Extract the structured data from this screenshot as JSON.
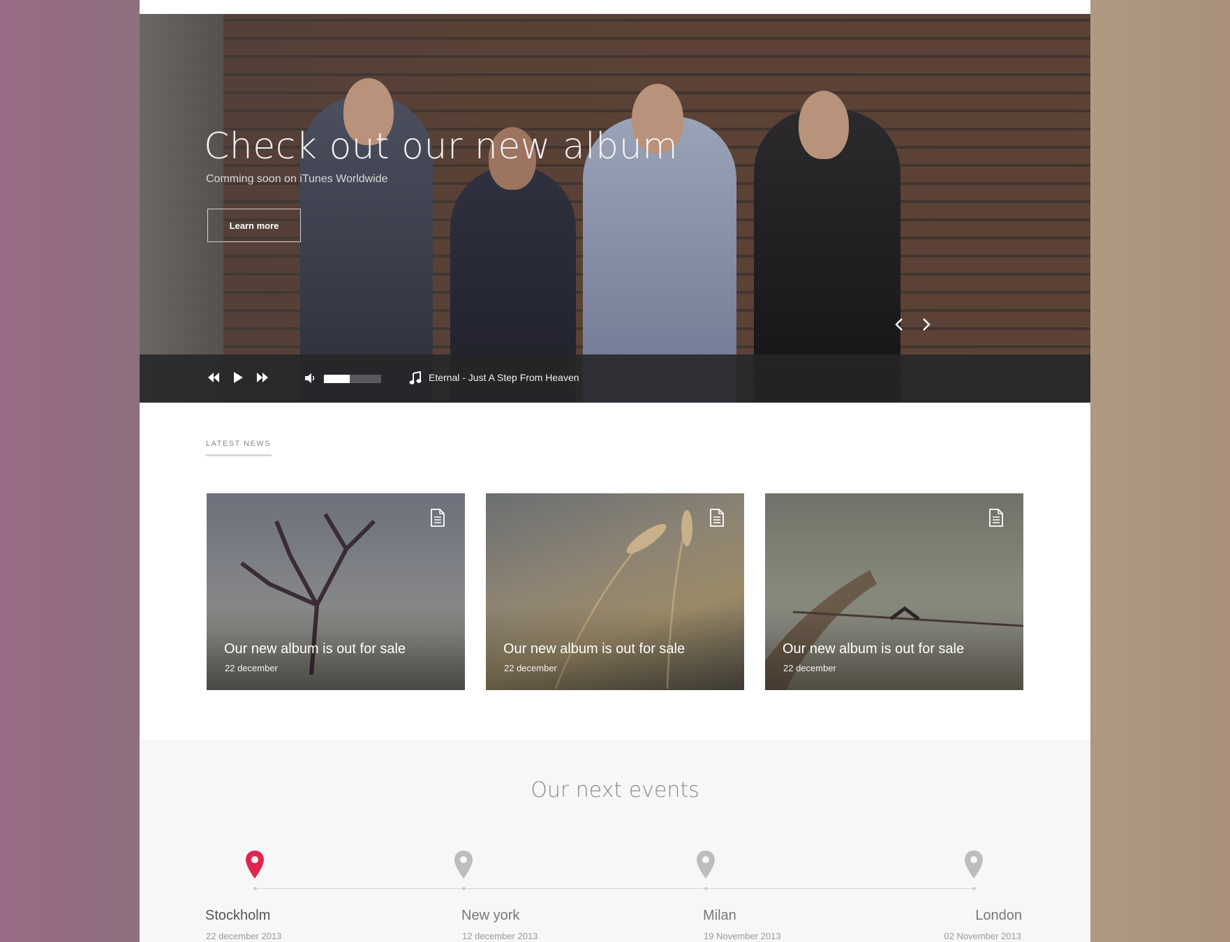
{
  "hero": {
    "title": "Check out our new album",
    "subtitle": "Comming soon on iTunes Worldwide",
    "cta_label": "Learn more"
  },
  "player": {
    "track": "Eternal - Just A Step From Heaven",
    "volume_level": 0.45,
    "icons": [
      "rewind-icon",
      "play-icon",
      "fast-forward-icon",
      "volume-icon",
      "music-note-icon"
    ]
  },
  "slider": {
    "icons": [
      "chevron-left-icon",
      "chevron-right-icon"
    ]
  },
  "news": {
    "heading": "LATEST NEWS",
    "items": [
      {
        "title": "Our new album is out for sale",
        "date": "22 december"
      },
      {
        "title": "Our new album is out for sale",
        "date": "22 december"
      },
      {
        "title": "Our new album is out for sale",
        "date": "22 december"
      }
    ]
  },
  "events": {
    "heading": "Our next events",
    "items": [
      {
        "city": "Stockholm",
        "date": "22 december 2013"
      },
      {
        "city": "New york",
        "date": "12 december 2013"
      },
      {
        "city": "Milan",
        "date": "19 November 2013"
      },
      {
        "city": "London",
        "date": "02 November 2013"
      }
    ]
  },
  "colors": {
    "accent": "#e0254e",
    "pin_inactive": "#bdbdbd"
  }
}
